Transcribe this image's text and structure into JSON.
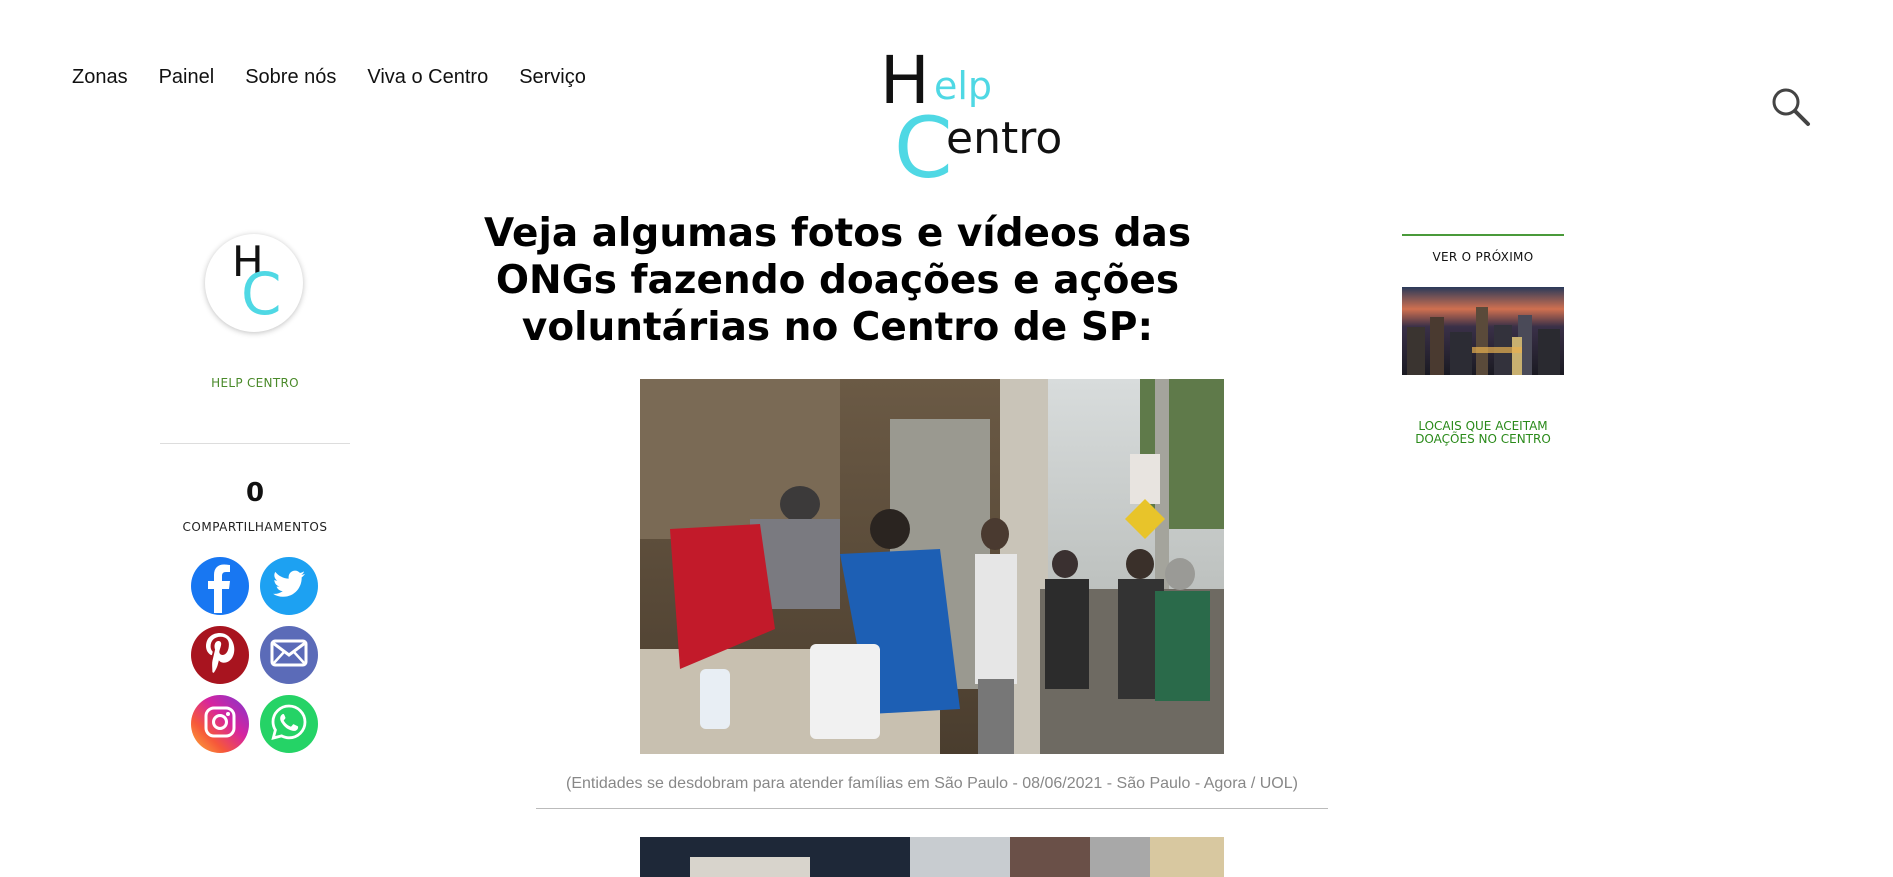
{
  "nav": {
    "items": [
      {
        "label": "Zonas"
      },
      {
        "label": "Painel"
      },
      {
        "label": "Sobre nós"
      },
      {
        "label": "Viva o Centro"
      },
      {
        "label": "Serviço"
      }
    ]
  },
  "logo": {
    "h": "H",
    "elp": "elp",
    "c": "C",
    "entro": "entro"
  },
  "avatar": {
    "h": "H",
    "c": "C"
  },
  "author": {
    "name": "HELP CENTRO"
  },
  "share": {
    "count": "0",
    "label": "COMPARTILHAMENTOS"
  },
  "social": [
    {
      "icon": "facebook-icon",
      "color": "#1877f2"
    },
    {
      "icon": "twitter-icon",
      "color": "#1da1f2"
    },
    {
      "icon": "pinterest-icon",
      "color": "#bd081c"
    },
    {
      "icon": "email-icon",
      "color": "#5b6bb8"
    },
    {
      "icon": "instagram-icon",
      "color": "#d6249f"
    },
    {
      "icon": "whatsapp-icon",
      "color": "#25d366"
    }
  ],
  "article": {
    "title": "Veja algumas fotos e vídeos das ONGs fazendo doações e ações voluntárias no Centro de SP:",
    "caption": "(Entidades se desdobram para atender famílias em São Paulo - 08/06/2021 - São Paulo - Agora / UOL)"
  },
  "next": {
    "label": "VER O PRÓXIMO",
    "link": "LOCAIS QUE ACEITAM DOAÇÕES NO CENTRO"
  },
  "colors": {
    "brand_cyan": "#4fd8e4",
    "accent_green": "#4a9a3a"
  }
}
